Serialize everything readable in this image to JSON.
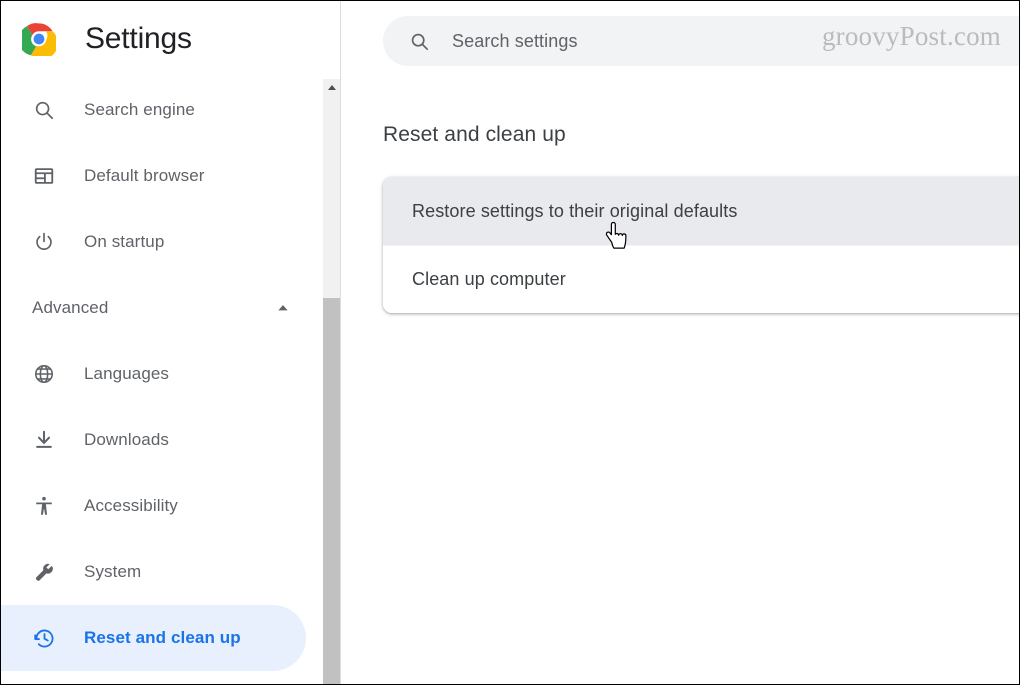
{
  "brand": {
    "title": "Settings",
    "logo_icon": "chrome-logo"
  },
  "sidebar": {
    "items": [
      {
        "label": "Search engine",
        "icon": "search-icon",
        "active": false
      },
      {
        "label": "Default browser",
        "icon": "browser-window-icon",
        "active": false
      },
      {
        "label": "On startup",
        "icon": "power-icon",
        "active": false
      }
    ],
    "section": {
      "label": "Advanced",
      "expanded": true,
      "chevron_icon": "chevron-up-icon"
    },
    "advanced_items": [
      {
        "label": "Languages",
        "icon": "globe-icon",
        "active": false
      },
      {
        "label": "Downloads",
        "icon": "download-icon",
        "active": false
      },
      {
        "label": "Accessibility",
        "icon": "accessibility-icon",
        "active": false
      },
      {
        "label": "System",
        "icon": "wrench-icon",
        "active": false
      },
      {
        "label": "Reset and clean up",
        "icon": "restore-history-icon",
        "active": true
      }
    ],
    "scrollbar": {
      "up_arrow_icon": "scroll-up-arrow-icon",
      "thumb_label": "scrollbar-thumb"
    }
  },
  "search": {
    "value": "",
    "placeholder": "Search settings",
    "icon": "search-icon"
  },
  "watermark": {
    "text": "groovyPost.com"
  },
  "main": {
    "heading": "Reset and clean up",
    "rows": [
      {
        "label": "Restore settings to their original defaults",
        "hovered": true
      },
      {
        "label": "Clean up computer",
        "hovered": false
      }
    ]
  },
  "cursor": {
    "type": "pointer-hand-cursor"
  },
  "colors": {
    "accent_blue": "#1a73e8",
    "active_pill_bg": "#e8f0fe",
    "text_primary": "#202124",
    "text_secondary": "#5f6368",
    "search_bg": "#f1f3f4",
    "row_hover_bg": "#e8eaed",
    "scrollbar_track": "#f1f1f1",
    "scrollbar_thumb": "#c1c1c1"
  }
}
